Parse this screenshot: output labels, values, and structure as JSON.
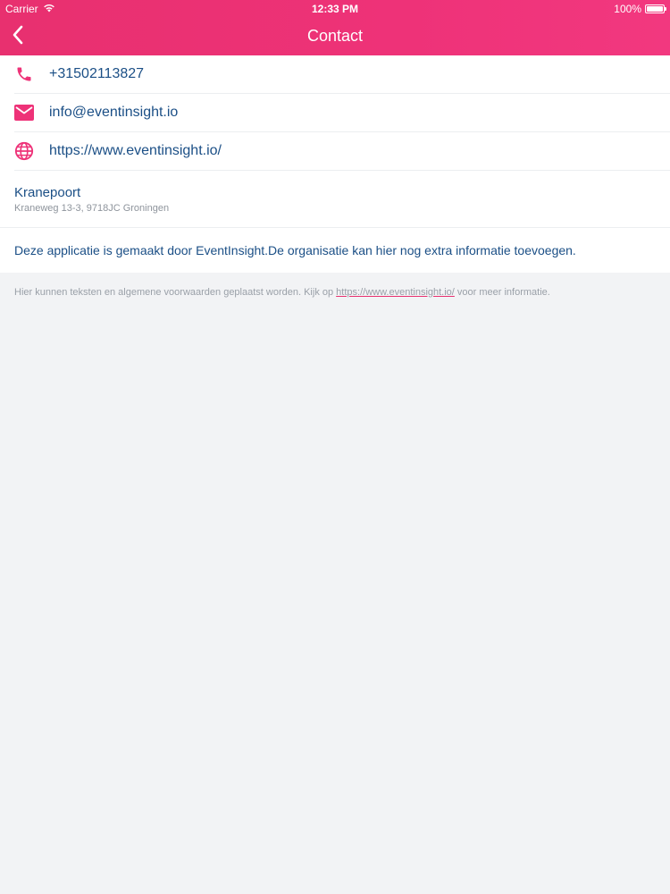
{
  "status_bar": {
    "carrier": "Carrier",
    "time": "12:33 PM",
    "battery": "100%",
    "battery_level": 1.0
  },
  "header": {
    "title": "Contact",
    "back_icon": "chevron-left-icon"
  },
  "contact": {
    "phone": "+31502113827",
    "email": "info@eventinsight.io",
    "website": "https://www.eventinsight.io/"
  },
  "address": {
    "name": "Kranepoort",
    "line": "Kraneweg 13-3, 9718JC Groningen"
  },
  "info": {
    "text": "Deze applicatie is gemaakt door EventInsight.De organisatie kan hier nog extra informatie toevoegen."
  },
  "terms": {
    "prefix": "Hier kunnen teksten en algemene voorwaarden geplaatst worden. Kijk op ",
    "link": "https://www.eventinsight.io/",
    "suffix": " voor meer informatie."
  },
  "colors": {
    "accent": "#ee3278",
    "text_primary": "#1b4f86",
    "text_secondary": "#8e949c",
    "background": "#f2f3f5"
  }
}
